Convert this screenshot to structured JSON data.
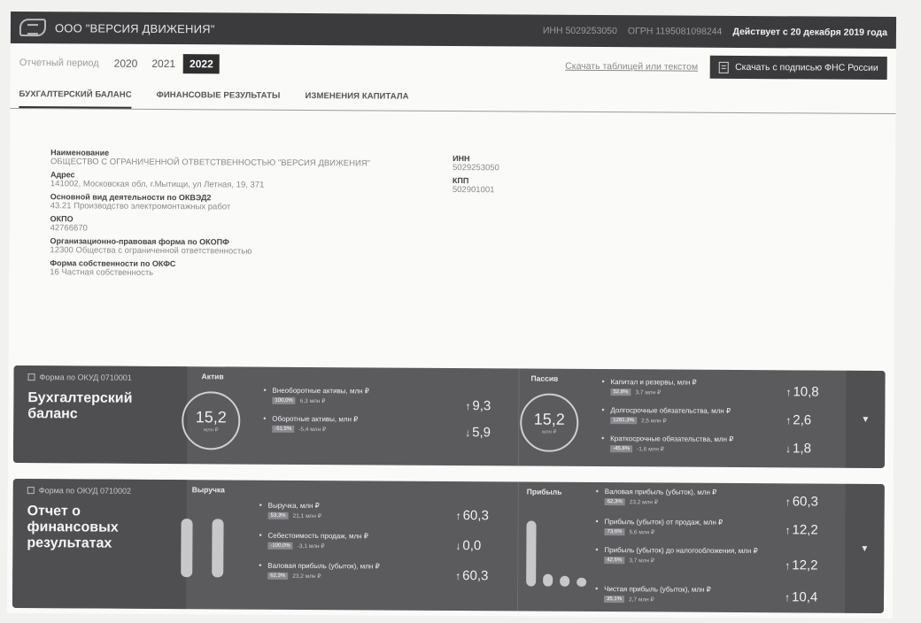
{
  "header": {
    "company": "ООО \"ВЕРСИЯ ДВИЖЕНИЯ\"",
    "inn": "ИНН 5029253050",
    "ogrn": "ОГРН 1195081098244",
    "status": "Действует с 20 декабря 2019 года"
  },
  "period": {
    "label": "Отчетный период",
    "years": [
      "2020",
      "2021",
      "2022"
    ],
    "active": "2022",
    "download_link": "Скачать таблицей или текстом",
    "fns_button": "Скачать с подписью ФНС России"
  },
  "tabs": [
    "БУХГАЛТЕРСКИЙ БАЛАНС",
    "ФИНАНСОВЫЕ РЕЗУЛЬТАТЫ",
    "ИЗМЕНЕНИЯ КАПИТАЛА"
  ],
  "info": {
    "name_label": "Наименование",
    "name_value": "ОБЩЕСТВО С ОГРАНИЧЕННОЙ ОТВЕТСТВЕННОСТЬЮ \"ВЕРСИЯ ДВИЖЕНИЯ\"",
    "address_label": "Адрес",
    "address_value": "141002, Московская обл, г.Мытищи, ул Летная, 19, 371",
    "okved_label": "Основной вид деятельности по ОКВЭД2",
    "okved_value": "43.21 Производство электромонтажных работ",
    "okpo_label": "ОКПО",
    "okpo_value": "42766670",
    "okopf_label": "Организационно-правовая форма по ОКОПФ",
    "okopf_value": "12300 Общества с ограниченной ответственностью",
    "okfs_label": "Форма собственности по ОКФС",
    "okfs_value": "16 Частная собственность",
    "inn_label": "ИНН",
    "inn_value": "5029253050",
    "kpp_label": "КПП",
    "kpp_value": "502901001"
  },
  "balance": {
    "okud": "Форма по ОКУД 0710001",
    "title": "Бухгалтерский баланс",
    "assets_title": "Актив",
    "assets_total": "15,2",
    "assets_unit": "млн ₽",
    "assets_items": [
      {
        "label": "Внеоборотные активы, млн ₽",
        "pct": "100,0%",
        "sub": "6,3 млн ₽",
        "delta": "9,3",
        "arrow": "↑"
      },
      {
        "label": "Оборотные активы, млн ₽",
        "pct": "-51,5%",
        "sub": "-5,4 млн ₽",
        "delta": "5,9",
        "arrow": "↓"
      }
    ],
    "liabilities_title": "Пассив",
    "liabilities_total": "15,2",
    "liabilities_unit": "млн ₽",
    "liabilities_items": [
      {
        "label": "Капитал и резервы, млн ₽",
        "pct": "52,8%",
        "sub": "3,7 млн ₽",
        "delta": "10,8",
        "arrow": "↑"
      },
      {
        "label": "Долгосрочные обязательства, млн ₽",
        "pct": "1281,3%",
        "sub": "2,5 млн ₽",
        "delta": "2,6",
        "arrow": "↑"
      },
      {
        "label": "Краткосрочные обязательства, млн ₽",
        "pct": "-45,8%",
        "sub": "-1,6 млн ₽",
        "delta": "1,8",
        "arrow": "↓"
      }
    ]
  },
  "results": {
    "okud": "Форма по ОКУД 0710002",
    "title": "Отчет о финансовых результатах",
    "revenue_title": "Выручка",
    "revenue_items": [
      {
        "label": "Выручка, млн ₽",
        "pct": "53,3%",
        "sub": "21,1 млн ₽",
        "delta": "60,3",
        "arrow": "↑"
      },
      {
        "label": "Себестоимость продаж, млн ₽",
        "pct": "-100,0%",
        "sub": "-3,1 млн ₽",
        "delta": "0,0",
        "arrow": "↓"
      },
      {
        "label": "Валовая прибыль (убыток), млн ₽",
        "pct": "62,3%",
        "sub": "23,2 млн ₽",
        "delta": "60,3",
        "arrow": "↑"
      }
    ],
    "profit_title": "Прибыль",
    "profit_items": [
      {
        "label": "Валовая прибыль (убыток), млн ₽",
        "pct": "62,3%",
        "sub": "23,2 млн ₽",
        "delta": "60,3",
        "arrow": "↑"
      },
      {
        "label": "Прибыль (убыток) от продаж, млн ₽",
        "pct": "73,6%",
        "sub": "5,6 млн ₽",
        "delta": "12,2",
        "arrow": "↑"
      },
      {
        "label": "Прибыль (убыток) до налогообложения, млн ₽",
        "pct": "42,6%",
        "sub": "3,7 млн ₽",
        "delta": "12,2",
        "arrow": "↑"
      },
      {
        "label": "Чистая прибыль (убыток), млн ₽",
        "pct": "35,1%",
        "sub": "2,7 млн ₽",
        "delta": "10,4",
        "arrow": "↑"
      }
    ]
  },
  "colors": {
    "accent": "#2f2f31",
    "card": "#5b5b5e"
  }
}
